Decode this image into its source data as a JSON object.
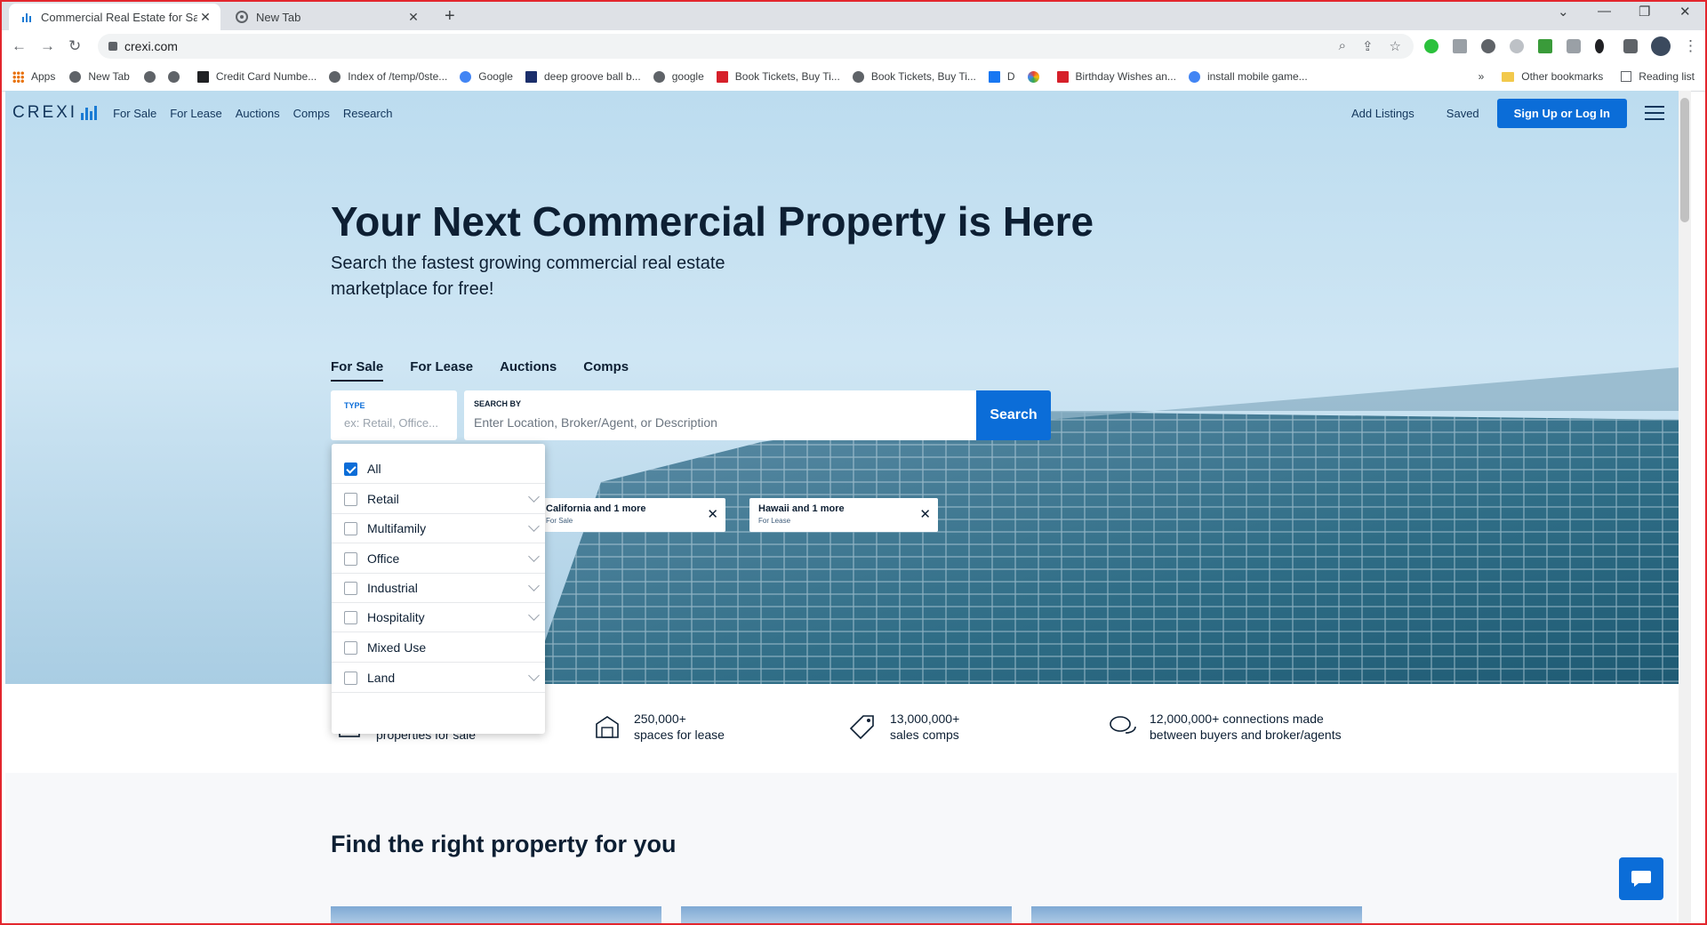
{
  "browser": {
    "tabs": [
      {
        "title": "Commercial Real Estate for Sale &",
        "close": "✕"
      },
      {
        "title": "New Tab",
        "close": "✕"
      }
    ],
    "new_tab": "+",
    "url": "crexi.com"
  },
  "bookmarks": {
    "items": [
      {
        "label": "Apps",
        "icon": "apps-grid-icon"
      },
      {
        "label": "New Tab",
        "icon": "globe-icon"
      },
      {
        "label": "",
        "icon": "globe-icon"
      },
      {
        "label": "",
        "icon": "globe-icon"
      },
      {
        "label": "Credit Card Numbe...",
        "icon": "ff-icon"
      },
      {
        "label": "Index of /temp/0ste...",
        "icon": "globe-icon"
      },
      {
        "label": "Google",
        "icon": "google-icon"
      },
      {
        "label": "deep groove ball b...",
        "icon": "hd-icon"
      },
      {
        "label": "google",
        "icon": "globe-icon"
      },
      {
        "label": "Book Tickets, Buy Ti...",
        "icon": "tickets-icon"
      },
      {
        "label": "Book Tickets, Buy Ti...",
        "icon": "globe-icon"
      },
      {
        "label": "D",
        "icon": "facebook-icon"
      },
      {
        "label": "",
        "icon": "ring-icon"
      },
      {
        "label": "Birthday Wishes an...",
        "icon": "quote-icon"
      },
      {
        "label": "install mobile game...",
        "icon": "google-icon"
      }
    ],
    "overflow": "»",
    "other": "Other bookmarks",
    "reading": "Reading list"
  },
  "site": {
    "logo": "CREXI",
    "nav": [
      "For Sale",
      "For Lease",
      "Auctions",
      "Comps",
      "Research"
    ],
    "add_listings": "Add Listings",
    "saved": "Saved",
    "signup": "Sign Up or Log In"
  },
  "hero": {
    "title": "Your Next Commercial Property is Here",
    "subtitle": "Search the fastest growing commercial real estate marketplace for free!",
    "tabs": [
      "For Sale",
      "For Lease",
      "Auctions",
      "Comps"
    ],
    "type_label": "TYPE",
    "type_placeholder": "ex: Retail, Office...",
    "search_label": "SEARCH BY",
    "search_placeholder": "Enter Location, Broker/Agent, or Description",
    "search_button": "Search"
  },
  "recent_searches": [
    {
      "title": "California and 1 more",
      "sub": "For Sale"
    },
    {
      "title": "Hawaii and 1 more",
      "sub": "For Lease"
    }
  ],
  "type_options": [
    {
      "label": "All",
      "checked": true,
      "expandable": false
    },
    {
      "label": "Retail",
      "checked": false,
      "expandable": true
    },
    {
      "label": "Multifamily",
      "checked": false,
      "expandable": true
    },
    {
      "label": "Office",
      "checked": false,
      "expandable": true
    },
    {
      "label": "Industrial",
      "checked": false,
      "expandable": true
    },
    {
      "label": "Hospitality",
      "checked": false,
      "expandable": true
    },
    {
      "label": "Mixed Use",
      "checked": false,
      "expandable": false
    },
    {
      "label": "Land",
      "checked": false,
      "expandable": true
    }
  ],
  "stats": [
    {
      "line1": "",
      "line2": "properties for sale",
      "icon": "building-icon"
    },
    {
      "line1": "250,000+",
      "line2": "spaces for lease",
      "icon": "storefront-icon"
    },
    {
      "line1": "13,000,000+",
      "line2": "sales comps",
      "icon": "price-tag-icon"
    },
    {
      "line1": "12,000,000+ connections made",
      "line2": "between buyers and broker/agents",
      "icon": "chat-bubbles-icon"
    }
  ],
  "section_title": "Find the right property for you",
  "colors": {
    "accent": "#0b6dd8",
    "navy": "#0d1f33",
    "frame": "#e3262d"
  }
}
